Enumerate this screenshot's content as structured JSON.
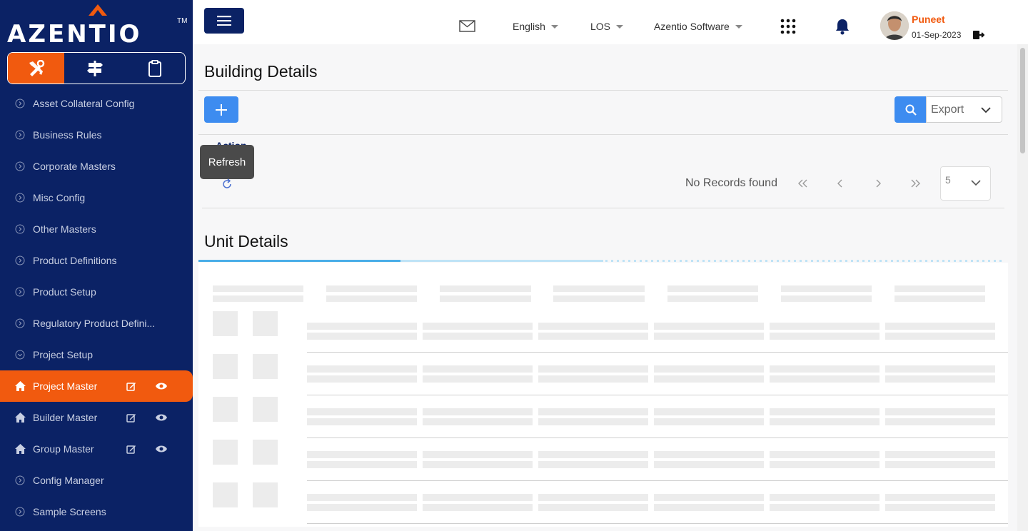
{
  "brand": {
    "name": "AZENTIO",
    "tm": "TM",
    "accent": "#f15a0f",
    "navy": "#0b2265"
  },
  "sidebar": {
    "tabs": [
      {
        "icon": "tools-icon",
        "active": true
      },
      {
        "icon": "signpost-icon",
        "active": false
      },
      {
        "icon": "clipboard-icon",
        "active": false
      }
    ],
    "items": [
      {
        "label": "Asset Collateral Config",
        "icon": "chevron-circle-icon"
      },
      {
        "label": "Business Rules",
        "icon": "chevron-circle-icon"
      },
      {
        "label": "Corporate Masters",
        "icon": "chevron-circle-icon"
      },
      {
        "label": "Misc Config",
        "icon": "chevron-circle-icon"
      },
      {
        "label": "Other Masters",
        "icon": "chevron-circle-icon"
      },
      {
        "label": "Product Definitions",
        "icon": "chevron-circle-icon"
      },
      {
        "label": "Product Setup",
        "icon": "chevron-circle-icon"
      },
      {
        "label": "Regulatory Product Defini...",
        "icon": "chevron-circle-icon"
      },
      {
        "label": "Project Setup",
        "icon": "chevron-circle-icon"
      },
      {
        "label": "Project Master",
        "icon": "home-icon",
        "active": true
      },
      {
        "label": "Builder Master",
        "icon": "home-icon"
      },
      {
        "label": "Group Master",
        "icon": "home-icon"
      },
      {
        "label": "Config Manager",
        "icon": "chevron-circle-icon"
      },
      {
        "label": "Sample Screens",
        "icon": "chevron-circle-icon"
      }
    ]
  },
  "header": {
    "language": "English",
    "module": "LOS",
    "company": "Azentio Software",
    "user": {
      "name": "Puneet",
      "date": "01-Sep-2023"
    }
  },
  "building": {
    "title": "Building Details",
    "export_label": "Export",
    "action_header": "Action",
    "tooltip": "Refresh",
    "no_records": "No Records found",
    "page_size": "5"
  },
  "unit": {
    "title": "Unit Details"
  }
}
